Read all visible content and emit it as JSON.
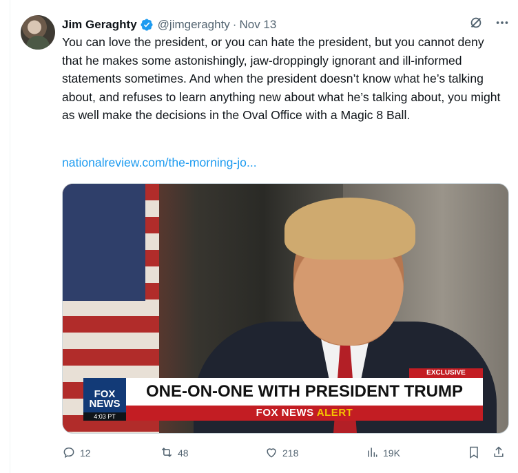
{
  "author": {
    "name": "Jim Geraghty",
    "handle": "@jimgeraghty",
    "separator": "·",
    "date": "Nov 13"
  },
  "tweet": {
    "text": "You can love the president, or you can hate the president, but you cannot deny that he makes some astonishingly, jaw-droppingly ignorant and ill-informed statements sometimes. And when the president doesn’t know what he’s talking about, and refuses to learn anything new about what he’s talking about, you might as well make the decisions in the Oval Office with a Magic 8 Ball.",
    "link_text": "nationalreview.com/the-morning-jo..."
  },
  "media": {
    "channel_top": "FOX",
    "channel_bottom": "NEWS",
    "timestamp": "4:03 PT",
    "tag": "EXCLUSIVE",
    "headline": "ONE-ON-ONE WITH PRESIDENT TRUMP",
    "alert_prefix": "FOX NEWS",
    "alert_word": "ALERT"
  },
  "actions": {
    "replies": "12",
    "reposts": "48",
    "likes": "218",
    "views": "19K"
  },
  "colors": {
    "link": "#1d9bf0",
    "muted": "#536471",
    "verified": "#1d9bf0"
  }
}
